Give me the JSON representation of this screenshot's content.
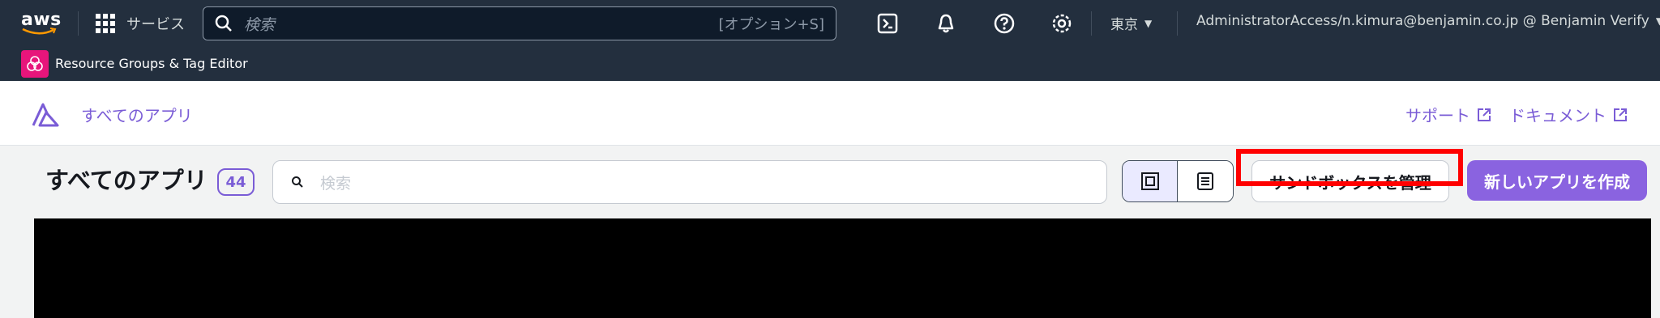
{
  "topnav": {
    "logo_text": "aws",
    "services_label": "サービス",
    "search_placeholder": "検索",
    "search_shortcut": "[オプション+S]",
    "region_label": "東京",
    "account_label": "AdministratorAccess/n.kimura@benjamin.co.jp @ Benjamin Verify"
  },
  "subnav": {
    "service_label": "Resource Groups & Tag Editor"
  },
  "appbar": {
    "brand_label": "すべてのアプリ",
    "support_label": "サポート",
    "docs_label": "ドキュメント"
  },
  "toolbar": {
    "title": "すべてのアプリ",
    "count": "44",
    "search_placeholder": "検索",
    "sandbox_button_label": "サンドボックスを管理",
    "create_button_label": "新しいアプリを作成"
  },
  "colors": {
    "nav_bg": "#232f3e",
    "accent": "#7a5cd6",
    "highlight": "#ff0000",
    "resource_groups_badge": "#e7157b"
  },
  "icons": {
    "services": "grid-icon",
    "search": "search-icon",
    "cloudshell": "terminal-icon",
    "notifications": "bell-icon",
    "help": "help-icon",
    "settings": "gear-icon",
    "external": "external-link-icon",
    "grid_view": "grid-view-icon",
    "list_view": "list-view-icon"
  }
}
